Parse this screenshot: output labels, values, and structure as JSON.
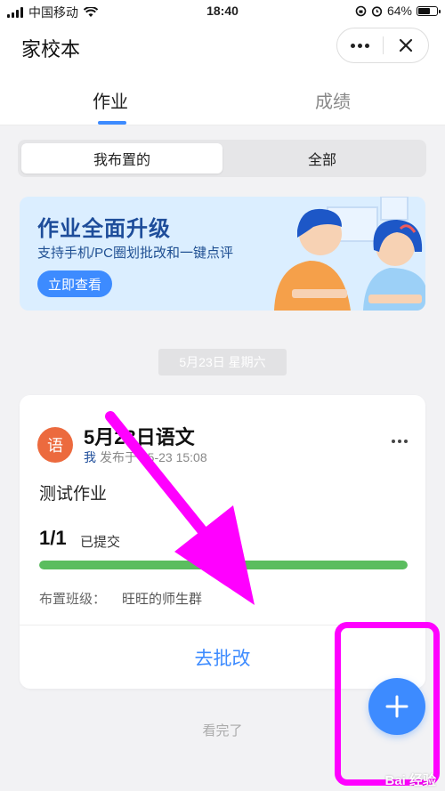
{
  "status_bar": {
    "carrier": "中国移动",
    "time": "18:40",
    "battery": "64%"
  },
  "header": {
    "title": "家校本"
  },
  "tabs": [
    {
      "label": "作业",
      "active": true
    },
    {
      "label": "成绩",
      "active": false
    }
  ],
  "segment": {
    "mine_label": "我布置的",
    "all_label": "全部"
  },
  "banner": {
    "title": "作业全面升级",
    "subtitle": "支持手机/PC圈划批改和一键点评",
    "button_label": "立即查看"
  },
  "date_chip": "5月23日 星期六",
  "card": {
    "subject_badge": "语",
    "title": "5月23日语文",
    "meta_me": "我",
    "meta_rest": "发布于 05-23 15:08",
    "body": "测试作业",
    "progress_count": "1/1",
    "progress_label": "已提交",
    "progress_fraction": 1.0,
    "class_label": "布置班级：",
    "class_name": "旺旺的师生群",
    "action_label": "去批改"
  },
  "footer_text": "看完了",
  "watermark": "Bai 经验",
  "colors": {
    "accent": "#3d8bff",
    "progress": "#5bbd5f",
    "subject_badge": "#ec6a3e",
    "annotation": "#ff00ff"
  }
}
